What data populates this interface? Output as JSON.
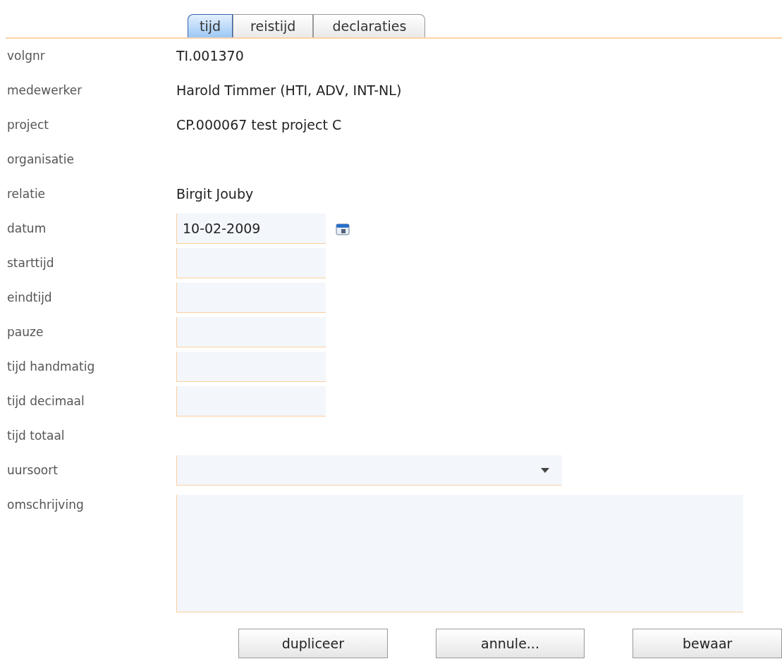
{
  "tabs": [
    {
      "label": "tijd",
      "selected": true
    },
    {
      "label": "reistijd",
      "selected": false
    },
    {
      "label": "declaraties",
      "selected": false
    }
  ],
  "fields": [
    {
      "label": "volgnr",
      "kind": "text",
      "value": "TI.001370"
    },
    {
      "label": "medewerker",
      "kind": "text",
      "value": "Harold Timmer (HTI, ADV, INT-NL)"
    },
    {
      "label": "project",
      "kind": "text",
      "value": "CP.000067 test project C"
    },
    {
      "label": "organisatie",
      "kind": "text"
    },
    {
      "label": "relatie",
      "kind": "text",
      "value": "Birgit Jouby"
    },
    {
      "label": "datum",
      "kind": "date",
      "value": "10-02-2009"
    },
    {
      "label": "starttijd",
      "kind": "input"
    },
    {
      "label": "eindtijd",
      "kind": "input"
    },
    {
      "label": "pauze",
      "kind": "input"
    },
    {
      "label": "tijd handmatig",
      "kind": "input"
    },
    {
      "label": "tijd decimaal",
      "kind": "input"
    },
    {
      "label": "tijd totaal",
      "kind": "text"
    },
    {
      "label": "uursoort",
      "kind": "select"
    },
    {
      "label": "omschrijving",
      "kind": "textarea"
    }
  ],
  "buttons": [
    "dupliceer",
    "annule...",
    "bewaar"
  ]
}
